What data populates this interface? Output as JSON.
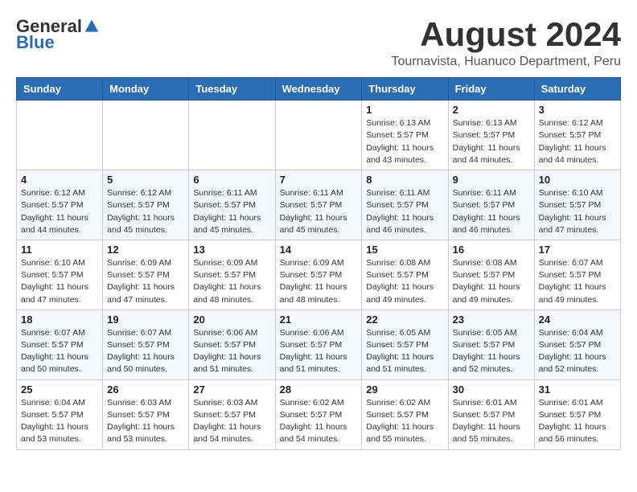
{
  "header": {
    "logo_general": "General",
    "logo_blue": "Blue",
    "month_year": "August 2024",
    "location": "Tournavista, Huanuco Department, Peru"
  },
  "weekdays": [
    "Sunday",
    "Monday",
    "Tuesday",
    "Wednesday",
    "Thursday",
    "Friday",
    "Saturday"
  ],
  "weeks": [
    [
      {
        "day": "",
        "info": ""
      },
      {
        "day": "",
        "info": ""
      },
      {
        "day": "",
        "info": ""
      },
      {
        "day": "",
        "info": ""
      },
      {
        "day": "1",
        "info": "Sunrise: 6:13 AM\nSunset: 5:57 PM\nDaylight: 11 hours and 43 minutes."
      },
      {
        "day": "2",
        "info": "Sunrise: 6:13 AM\nSunset: 5:57 PM\nDaylight: 11 hours and 44 minutes."
      },
      {
        "day": "3",
        "info": "Sunrise: 6:12 AM\nSunset: 5:57 PM\nDaylight: 11 hours and 44 minutes."
      }
    ],
    [
      {
        "day": "4",
        "info": "Sunrise: 6:12 AM\nSunset: 5:57 PM\nDaylight: 11 hours and 44 minutes."
      },
      {
        "day": "5",
        "info": "Sunrise: 6:12 AM\nSunset: 5:57 PM\nDaylight: 11 hours and 45 minutes."
      },
      {
        "day": "6",
        "info": "Sunrise: 6:11 AM\nSunset: 5:57 PM\nDaylight: 11 hours and 45 minutes."
      },
      {
        "day": "7",
        "info": "Sunrise: 6:11 AM\nSunset: 5:57 PM\nDaylight: 11 hours and 45 minutes."
      },
      {
        "day": "8",
        "info": "Sunrise: 6:11 AM\nSunset: 5:57 PM\nDaylight: 11 hours and 46 minutes."
      },
      {
        "day": "9",
        "info": "Sunrise: 6:11 AM\nSunset: 5:57 PM\nDaylight: 11 hours and 46 minutes."
      },
      {
        "day": "10",
        "info": "Sunrise: 6:10 AM\nSunset: 5:57 PM\nDaylight: 11 hours and 47 minutes."
      }
    ],
    [
      {
        "day": "11",
        "info": "Sunrise: 6:10 AM\nSunset: 5:57 PM\nDaylight: 11 hours and 47 minutes."
      },
      {
        "day": "12",
        "info": "Sunrise: 6:09 AM\nSunset: 5:57 PM\nDaylight: 11 hours and 47 minutes."
      },
      {
        "day": "13",
        "info": "Sunrise: 6:09 AM\nSunset: 5:57 PM\nDaylight: 11 hours and 48 minutes."
      },
      {
        "day": "14",
        "info": "Sunrise: 6:09 AM\nSunset: 5:57 PM\nDaylight: 11 hours and 48 minutes."
      },
      {
        "day": "15",
        "info": "Sunrise: 6:08 AM\nSunset: 5:57 PM\nDaylight: 11 hours and 49 minutes."
      },
      {
        "day": "16",
        "info": "Sunrise: 6:08 AM\nSunset: 5:57 PM\nDaylight: 11 hours and 49 minutes."
      },
      {
        "day": "17",
        "info": "Sunrise: 6:07 AM\nSunset: 5:57 PM\nDaylight: 11 hours and 49 minutes."
      }
    ],
    [
      {
        "day": "18",
        "info": "Sunrise: 6:07 AM\nSunset: 5:57 PM\nDaylight: 11 hours and 50 minutes."
      },
      {
        "day": "19",
        "info": "Sunrise: 6:07 AM\nSunset: 5:57 PM\nDaylight: 11 hours and 50 minutes."
      },
      {
        "day": "20",
        "info": "Sunrise: 6:06 AM\nSunset: 5:57 PM\nDaylight: 11 hours and 51 minutes."
      },
      {
        "day": "21",
        "info": "Sunrise: 6:06 AM\nSunset: 5:57 PM\nDaylight: 11 hours and 51 minutes."
      },
      {
        "day": "22",
        "info": "Sunrise: 6:05 AM\nSunset: 5:57 PM\nDaylight: 11 hours and 51 minutes."
      },
      {
        "day": "23",
        "info": "Sunrise: 6:05 AM\nSunset: 5:57 PM\nDaylight: 11 hours and 52 minutes."
      },
      {
        "day": "24",
        "info": "Sunrise: 6:04 AM\nSunset: 5:57 PM\nDaylight: 11 hours and 52 minutes."
      }
    ],
    [
      {
        "day": "25",
        "info": "Sunrise: 6:04 AM\nSunset: 5:57 PM\nDaylight: 11 hours and 53 minutes."
      },
      {
        "day": "26",
        "info": "Sunrise: 6:03 AM\nSunset: 5:57 PM\nDaylight: 11 hours and 53 minutes."
      },
      {
        "day": "27",
        "info": "Sunrise: 6:03 AM\nSunset: 5:57 PM\nDaylight: 11 hours and 54 minutes."
      },
      {
        "day": "28",
        "info": "Sunrise: 6:02 AM\nSunset: 5:57 PM\nDaylight: 11 hours and 54 minutes."
      },
      {
        "day": "29",
        "info": "Sunrise: 6:02 AM\nSunset: 5:57 PM\nDaylight: 11 hours and 55 minutes."
      },
      {
        "day": "30",
        "info": "Sunrise: 6:01 AM\nSunset: 5:57 PM\nDaylight: 11 hours and 55 minutes."
      },
      {
        "day": "31",
        "info": "Sunrise: 6:01 AM\nSunset: 5:57 PM\nDaylight: 11 hours and 56 minutes."
      }
    ]
  ]
}
